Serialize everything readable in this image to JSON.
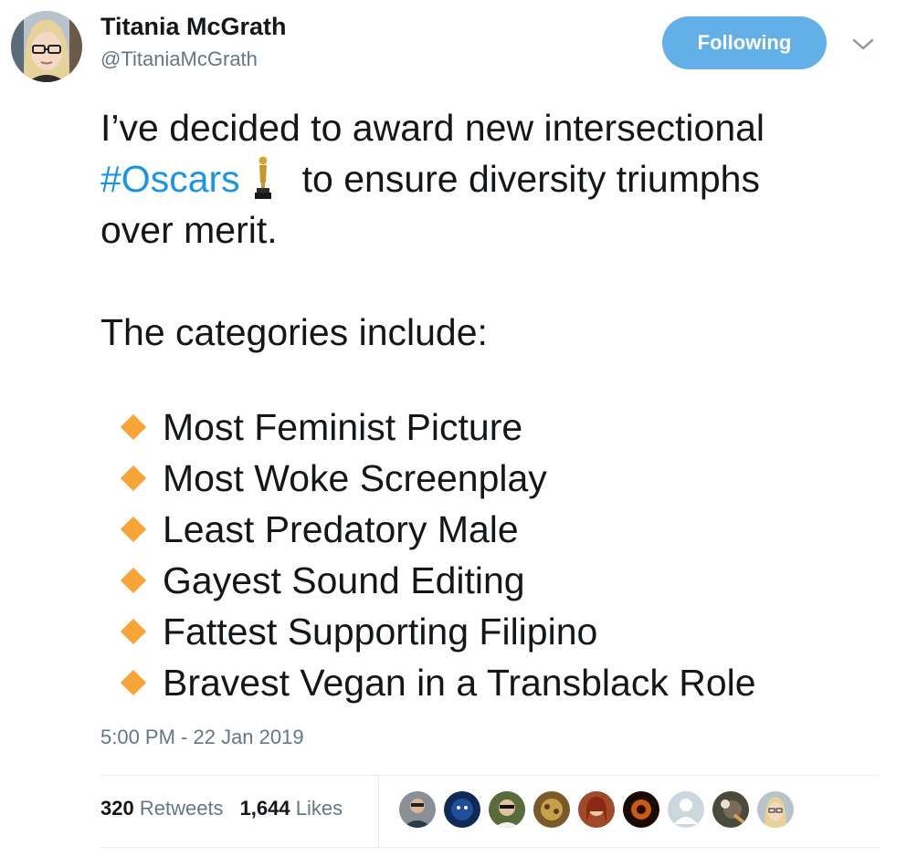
{
  "author": {
    "name": "Titania McGrath",
    "handle": "@TitaniaMcGrath"
  },
  "follow_button_label": "Following",
  "tweet": {
    "line1": "I’ve decided to award new intersectional",
    "hashtag": "#Oscars",
    "line2_rest": "to ensure diversity triumphs",
    "line3": "over merit.",
    "intro": "The categories include:",
    "categories": [
      "Most Feminist Picture",
      "Most Woke Screenplay",
      "Least Predatory Male",
      "Gayest Sound Editing",
      "Fattest Supporting Filipino",
      "Bravest Vegan in a Transblack Role"
    ],
    "timestamp": "5:00 PM - 22 Jan 2019"
  },
  "stats": {
    "retweets_count": "320",
    "retweets_label": "Retweets",
    "likes_count": "1,644",
    "likes_label": "Likes"
  },
  "icons": {
    "trophy": "oscar-trophy-icon",
    "bullet": "orange-diamond-icon",
    "caret": "chevron-down-icon"
  },
  "colors": {
    "accent": "#1b95e0",
    "follow_button": "#63b0e9",
    "bullet": "#f7a53a",
    "secondary_text": "#657786"
  }
}
